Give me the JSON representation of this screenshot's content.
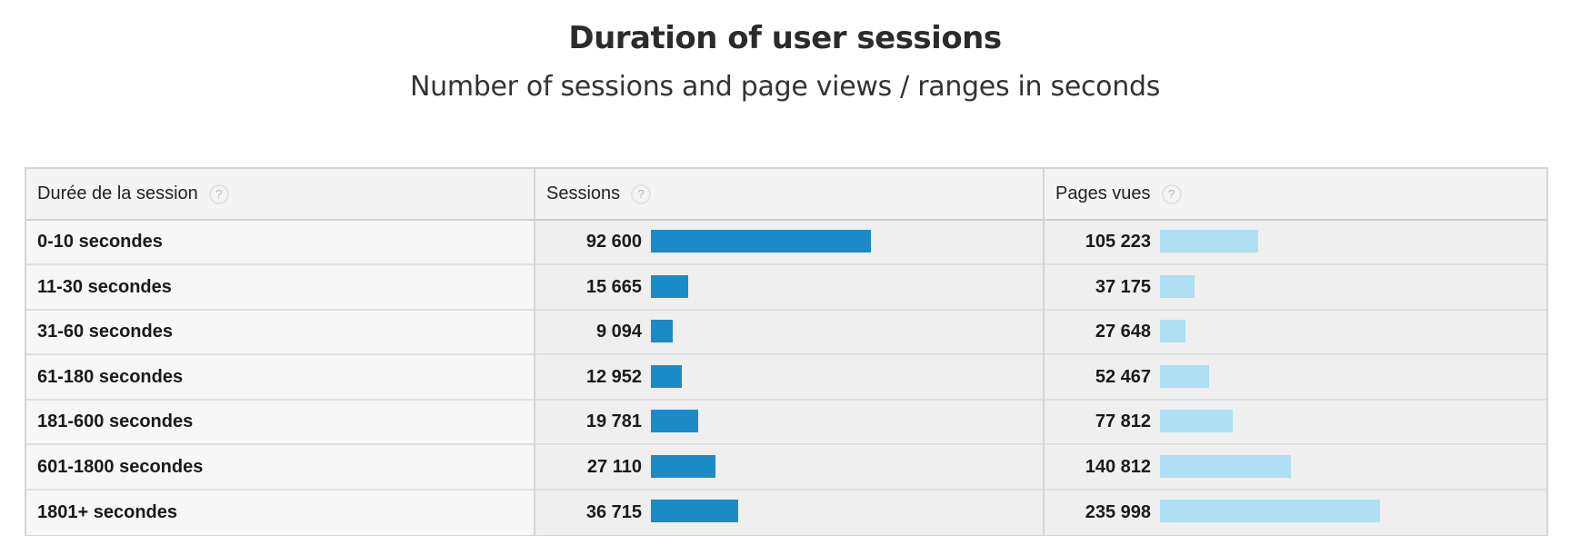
{
  "title": "Duration of user sessions",
  "subtitle": "Number of sessions and page views / ranges in seconds",
  "columns": {
    "duration": "Durée de la session",
    "sessions": "Sessions",
    "pageviews": "Pages vues",
    "help_glyph": "?"
  },
  "colors": {
    "sessions_bar": "#1b8bc8",
    "pageviews_bar": "#aedff3"
  },
  "chart_data": {
    "type": "table",
    "title": "Duration of user sessions",
    "subtitle": "Number of sessions and page views / ranges in seconds",
    "categories": [
      "0-10 secondes",
      "11-30 secondes",
      "31-60 secondes",
      "61-180 secondes",
      "181-600 secondes",
      "601-1800 secondes",
      "1801+ secondes"
    ],
    "series": [
      {
        "name": "Sessions",
        "values": [
          92600,
          15665,
          9094,
          12952,
          19781,
          27110,
          36715
        ],
        "labels": [
          "92 600",
          "15 665",
          "9 094",
          "12 952",
          "19 781",
          "27 110",
          "36 715"
        ]
      },
      {
        "name": "Pages vues",
        "values": [
          105223,
          37175,
          27648,
          52467,
          77812,
          140812,
          235998
        ],
        "labels": [
          "105 223",
          "37 175",
          "27 648",
          "52 467",
          "77 812",
          "140 812",
          "235 998"
        ]
      }
    ]
  }
}
